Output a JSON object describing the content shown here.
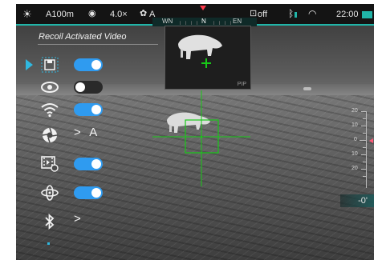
{
  "status_bar": {
    "range": "A100m",
    "zoom": "4.0×",
    "mode": "A",
    "record": "off",
    "time": "22:00"
  },
  "compass": {
    "west": "WN",
    "north": "N",
    "east": "EN"
  },
  "pip": {
    "label": "PIP"
  },
  "menu": {
    "title": "Recoil Activated Video",
    "items": [
      {
        "name": "save",
        "icon": "save-icon",
        "control": "toggle",
        "on": true,
        "selected": true
      },
      {
        "name": "eye",
        "icon": "eye-icon",
        "control": "toggle",
        "on": false
      },
      {
        "name": "wifi",
        "icon": "wifi-icon",
        "control": "toggle",
        "on": true
      },
      {
        "name": "aperture",
        "icon": "aperture-icon",
        "control": "value",
        "value": "A"
      },
      {
        "name": "video-record",
        "icon": "video-record-icon",
        "control": "toggle",
        "on": true
      },
      {
        "name": "gyro",
        "icon": "gyro-icon",
        "control": "toggle",
        "on": true
      },
      {
        "name": "bluetooth",
        "icon": "bluetooth-icon",
        "control": "submenu"
      }
    ],
    "chevron": ">"
  },
  "scale": {
    "labels": [
      "20",
      "10",
      "0",
      "10",
      "20"
    ]
  },
  "tilt": {
    "value": "-0'"
  },
  "colors": {
    "accent": "#21b4a8",
    "toggle_on": "#2f9bf0",
    "reticle": "#18c818",
    "north_marker": "#ff3a4c"
  }
}
